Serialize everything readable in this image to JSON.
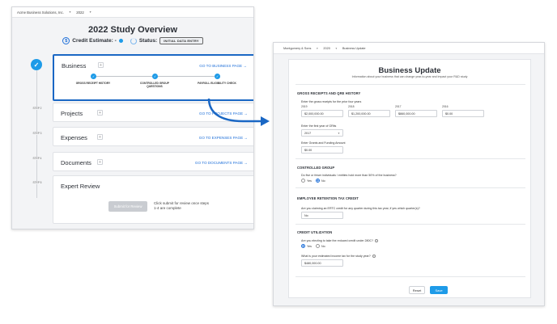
{
  "left": {
    "topbar": {
      "company": "Acme Business Solutions, Inc.",
      "year": "2022"
    },
    "title": "2022 Study Overview",
    "credit_label": "Credit Estimate: -",
    "status_label": "Status:",
    "status_badge": "INITIAL DATA ENTRY",
    "steps": {
      "step2": "STEP 2",
      "step3": "STEP 3",
      "step4": "STEP 4",
      "step5": "STEP 5"
    },
    "cards": {
      "business": {
        "title": "Business",
        "link": "GO TO BUSINESS PAGE →",
        "substeps": [
          "GROSS RECEIPT HISTORY",
          "CONTROLLED GROUP QUESTIONS",
          "PAYROLL ELIGIBILITY CHECK"
        ]
      },
      "projects": {
        "title": "Projects",
        "link": "GO TO PROJECTS PAGE →"
      },
      "expenses": {
        "title": "Expenses",
        "link": "GO TO EXPENSES PAGE →"
      },
      "documents": {
        "title": "Documents",
        "link": "GO TO DOCUMENTS PAGE →"
      },
      "expert": {
        "title": "Expert Review",
        "button": "Submit for Review",
        "note": "Click submit for review once steps 1-4 are complete"
      }
    }
  },
  "right": {
    "topbar": {
      "company": "Montgomery & Sons",
      "year": "2020",
      "page": "Business Update"
    },
    "title": "Business Update",
    "subtitle": "Information about your business that can change year-to-year and impact your R&D study",
    "gross": {
      "section": "GROSS RECEIPTS AND QRE HISTORY",
      "question": "Enter the gross receipts for the prior four years",
      "years": [
        "2019",
        "2018",
        "2017",
        "2016"
      ],
      "values": [
        "$2,000,000.00",
        "$1,200,000.00",
        "$860,000.00",
        "$0.00"
      ],
      "first_year_label": "Enter the first year of GRits",
      "first_year_value": "2017",
      "grants_label": "Enter Grants and Funding Amount",
      "grants_value": "$0.00"
    },
    "controlled": {
      "section": "CONTROLLED GROUP",
      "question": "Do five or fewer individuals / entities hold more than 50% of the business?",
      "yes": "Yes",
      "no": "No"
    },
    "ertc": {
      "section": "EMPLOYEE RETENTION TAX CREDIT",
      "question": "Are you claiming an ERTC credit for any quarter during this tax year, if yes which quarter(s)?",
      "value": "No"
    },
    "credit": {
      "section": "CREDIT UTILIZATION",
      "question1": "Are you electing to take the reduced credit under 280C?",
      "yes": "Yes",
      "no": "No",
      "question2": "What is your estimated income tax for the study year?",
      "value": "$480,000.00"
    },
    "buttons": {
      "reset": "Reset",
      "save": "Save"
    }
  },
  "colors": {
    "accent": "#1e9be8",
    "link": "#1e6fd9",
    "active_border": "#1a67c4"
  }
}
